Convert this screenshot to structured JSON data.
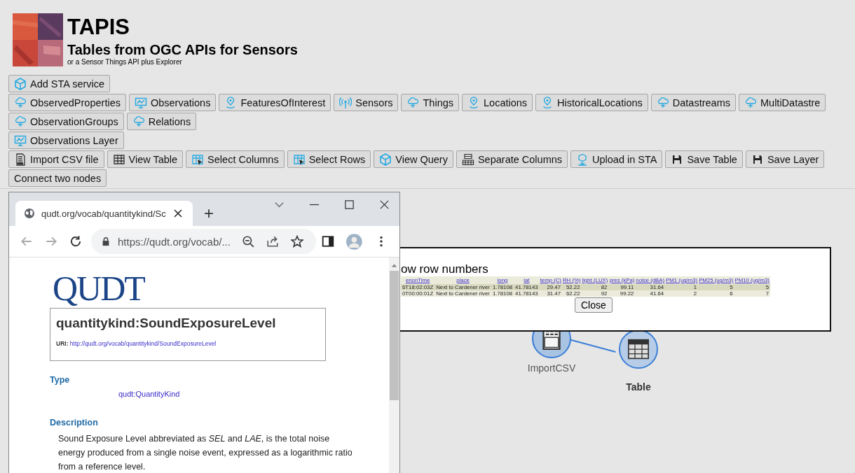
{
  "header": {
    "title": "TAPIS",
    "subtitle": "Tables from OGC APIs for Sensors",
    "tagline": "or a Sensor Things API plus Explorer"
  },
  "toolbar_rows": [
    {
      "buttons": [
        {
          "label": "Add STA service",
          "kind": "cube"
        }
      ]
    },
    {
      "buttons": [
        {
          "label": "ObservedProperties",
          "kind": "cloud"
        },
        {
          "label": "Observations",
          "kind": "monitor"
        },
        {
          "label": "FeaturesOfInterest",
          "kind": "pin"
        },
        {
          "label": "Sensors",
          "kind": "antenna"
        },
        {
          "label": "Things",
          "kind": "cloud"
        },
        {
          "label": "Locations",
          "kind": "pin"
        },
        {
          "label": "HistoricalLocations",
          "kind": "pin"
        },
        {
          "label": "Datastreams",
          "kind": "cloud"
        },
        {
          "label": "MultiDatastre",
          "kind": "cloud"
        }
      ]
    },
    {
      "buttons": [
        {
          "label": "ObservationGroups",
          "kind": "cloud"
        },
        {
          "label": "Relations",
          "kind": "cloud"
        }
      ]
    },
    {
      "buttons": [
        {
          "label": "Observations Layer",
          "kind": "monitor"
        }
      ]
    },
    {
      "buttons": [
        {
          "label": "Import CSV file",
          "kind": "csv"
        },
        {
          "label": "View Table",
          "kind": "table"
        },
        {
          "label": "Select Columns",
          "kind": "table-pointer"
        },
        {
          "label": "Select Rows",
          "kind": "table-pointer"
        },
        {
          "label": "View Query",
          "kind": "cube"
        },
        {
          "label": "Separate Columns",
          "kind": "grid"
        },
        {
          "label": "Upload in STA",
          "kind": "upload"
        },
        {
          "label": "Save Table",
          "kind": "save"
        },
        {
          "label": "Save Layer",
          "kind": "save"
        }
      ]
    },
    {
      "buttons": [
        {
          "label": "Connect two nodes",
          "kind": "text"
        }
      ]
    }
  ],
  "graph": {
    "nodes": [
      {
        "label": "ImportCSV",
        "kind": "csv",
        "selected": false
      },
      {
        "label": "Table",
        "kind": "table",
        "selected": true
      }
    ]
  },
  "dialog": {
    "title": "ow row numbers",
    "columns": [
      "enonTime",
      "place",
      "long",
      "lat",
      "temp (C)",
      "RH (%)",
      "light (LUX)",
      "pres (kPa)",
      "noise (dBA)",
      "PM1 (ug/m3)",
      "PM25 (ug/m3)",
      "PM10 (ug/m3)"
    ],
    "rows": [
      [
        "6T18:02:03Z",
        "Next to Cardener river",
        "1.78108",
        "41.78143",
        "29.47",
        "52.22",
        "82",
        "99.11",
        "31.64",
        "1",
        "5",
        "5"
      ],
      [
        "0T00:00:01Z",
        "Next to Cardener river",
        "1.78108",
        "41.78143",
        "31.47",
        "62.22",
        "92",
        "99.22",
        "41.64",
        "2",
        "6",
        "7"
      ]
    ],
    "close": "Close"
  },
  "browser": {
    "tab_title": "qudt.org/vocab/quantitykind/Sc",
    "new_tab": "+",
    "address": "https://qudt.org/vocab/...",
    "page": {
      "logo": "QUDT",
      "heading": "quantitykind:SoundExposureLevel",
      "uri_label": "URI:",
      "uri": "http://qudt.org/vocab/quantitykind/SoundExposureLevel",
      "type_heading": "Type",
      "type_value": "qudt:QuantityKind",
      "description_heading": "Description",
      "description": "Sound Exposure Level abbreviated as *SEL* and *LAE*, is the total noise energy produced from a single noise event, expressed as a logarithmic ratio from a reference level."
    }
  }
}
